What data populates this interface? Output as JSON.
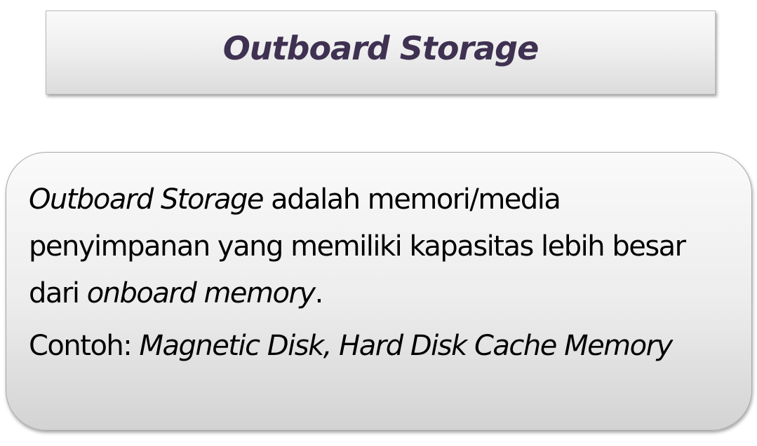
{
  "title": "Outboard Storage",
  "definition": {
    "term": "Outboard Storage",
    "text": " adalah memori/media penyimpanan yang memiliki kapasitas lebih besar dari ",
    "emphasis": "onboard memory",
    "end": "."
  },
  "example": {
    "label": "Contoh: ",
    "items": "Magnetic Disk, Hard Disk Cache Memory"
  }
}
